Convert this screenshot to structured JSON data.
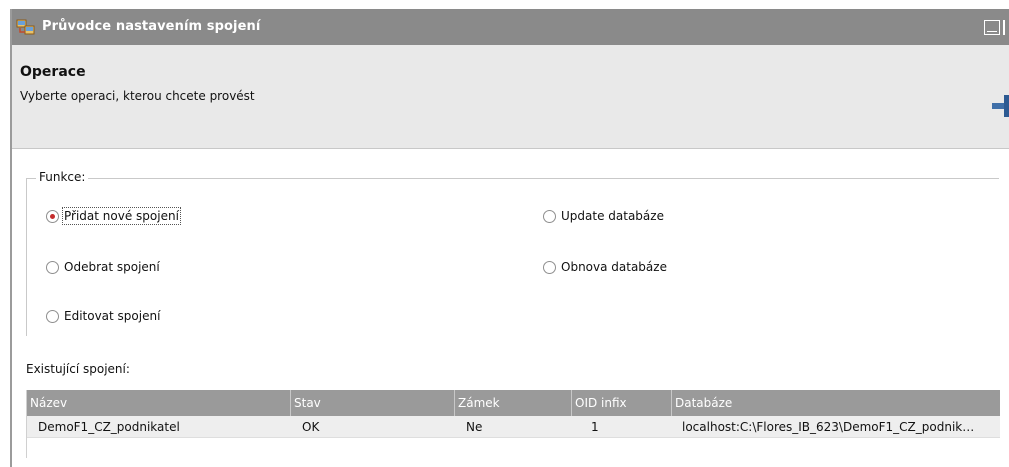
{
  "window": {
    "title": "Průvodce nastavením spojení",
    "icon": "wizard-app-icon"
  },
  "header": {
    "title": "Operace",
    "subtitle": "Vyberte operaci, kterou chcete provést"
  },
  "functions": {
    "legend": "Funkce:",
    "options": [
      {
        "label": "Přidat nové spojení",
        "checked": true
      },
      {
        "label": "Update databáze",
        "checked": false
      },
      {
        "label": "Odebrat spojení",
        "checked": false
      },
      {
        "label": "Obnova databáze",
        "checked": false
      },
      {
        "label": "Editovat spojení",
        "checked": false
      }
    ]
  },
  "connections": {
    "label": "Existující spojení:",
    "columns": [
      "Název",
      "Stav",
      "Zámek",
      "OID infix",
      "Databáze"
    ],
    "rows": [
      [
        "DemoF1_CZ_podnikatel",
        "OK",
        "Ne",
        "1",
        "localhost:C:\\Flores_IB_623\\DemoF1_CZ_podnik…"
      ]
    ]
  },
  "colors": {
    "titlebar": "#8a8a8a",
    "header_bg": "#e9e9e9",
    "grid_header": "#9a9a9a",
    "radio_checked": "#c42c2c"
  }
}
